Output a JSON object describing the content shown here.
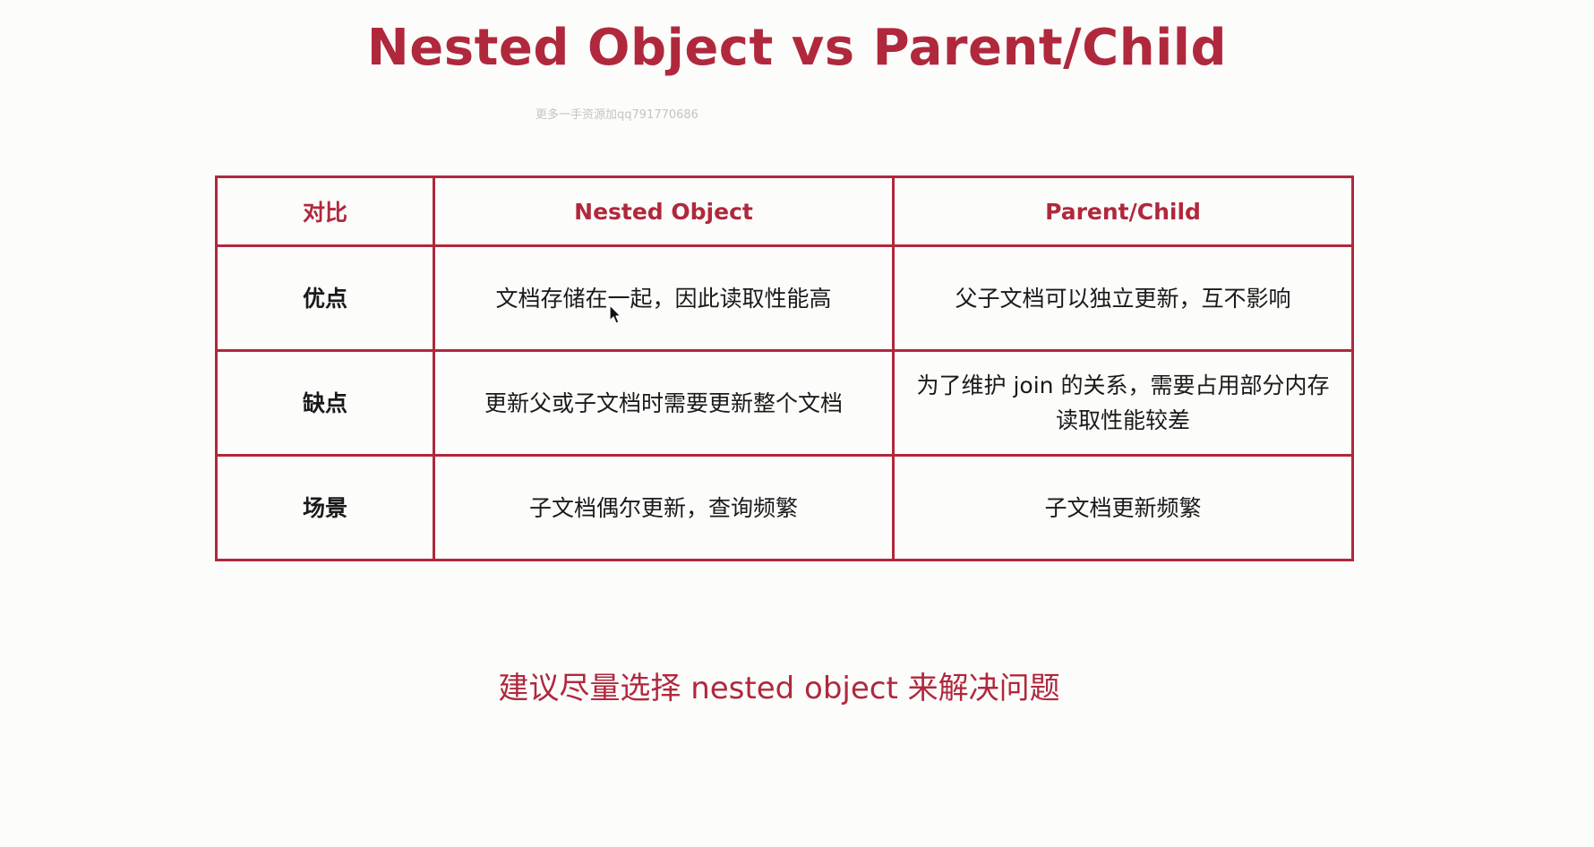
{
  "title": "Nested Object vs Parent/Child",
  "watermark": "更多一手资源加qq791770686",
  "table": {
    "headers": [
      "对比",
      "Nested Object",
      "Parent/Child"
    ],
    "rows": [
      {
        "label": "优点",
        "nested": "文档存储在一起，因此读取性能高",
        "parent_child": [
          "父子文档可以独立更新，互不影响"
        ]
      },
      {
        "label": "缺点",
        "nested": "更新父或子文档时需要更新整个文档",
        "parent_child": [
          "为了维护 join 的关系，需要占用部分内存",
          "读取性能较差"
        ]
      },
      {
        "label": "场景",
        "nested": "子文档偶尔更新，查询频繁",
        "parent_child": [
          "子文档更新频繁"
        ]
      }
    ]
  },
  "recommendation": "建议尽量选择 nested object 来解决问题",
  "colors": {
    "accent": "#b0283c",
    "text": "#1a1a1a",
    "background": "#fcfcfb"
  },
  "icons": {
    "cursor": "mouse-pointer-icon"
  }
}
